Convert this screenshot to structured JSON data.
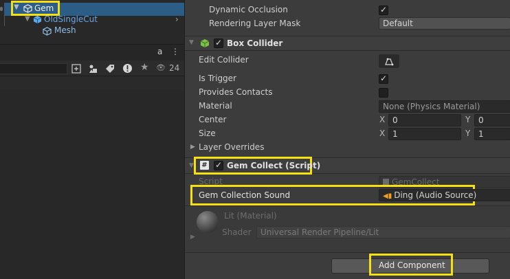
{
  "hierarchy": {
    "items": [
      {
        "label": "Gem"
      },
      {
        "label": "OldSingleCut"
      },
      {
        "label": "Mesh"
      }
    ],
    "lock_icon_label": "a",
    "visibility_count": "24"
  },
  "inspector": {
    "mesh_renderer": {
      "dynamic_occlusion_label": "Dynamic Occlusion",
      "rendering_layer_mask_label": "Rendering Layer Mask",
      "rendering_layer_mask_value": "Default"
    },
    "box_collider": {
      "title": "Box Collider",
      "edit_collider_label": "Edit Collider",
      "is_trigger_label": "Is Trigger",
      "provides_contacts_label": "Provides Contacts",
      "material_label": "Material",
      "material_value": "None (Physics Material)",
      "center_label": "Center",
      "center_x": "0",
      "center_y": "0",
      "size_label": "Size",
      "size_x": "1",
      "size_y": "1",
      "axis_x": "X",
      "axis_y": "Y",
      "layer_overrides_label": "Layer Overrides"
    },
    "gem_collect": {
      "title": "Gem Collect (Script)",
      "script_label": "Script",
      "script_value": "GemCollect",
      "sound_label": "Gem Collection Sound",
      "sound_value": "Ding (Audio Source)"
    },
    "material": {
      "name": "Lit (Material)",
      "shader_label": "Shader",
      "shader_value": "Universal Render Pipeline/Lit"
    },
    "add_component_label": "Add Component"
  },
  "colors": {
    "highlight": "#f7e010",
    "cube_blue": "#58a8ee",
    "cube_green": "#7cc04a",
    "audio_orange": "#f0a020"
  }
}
